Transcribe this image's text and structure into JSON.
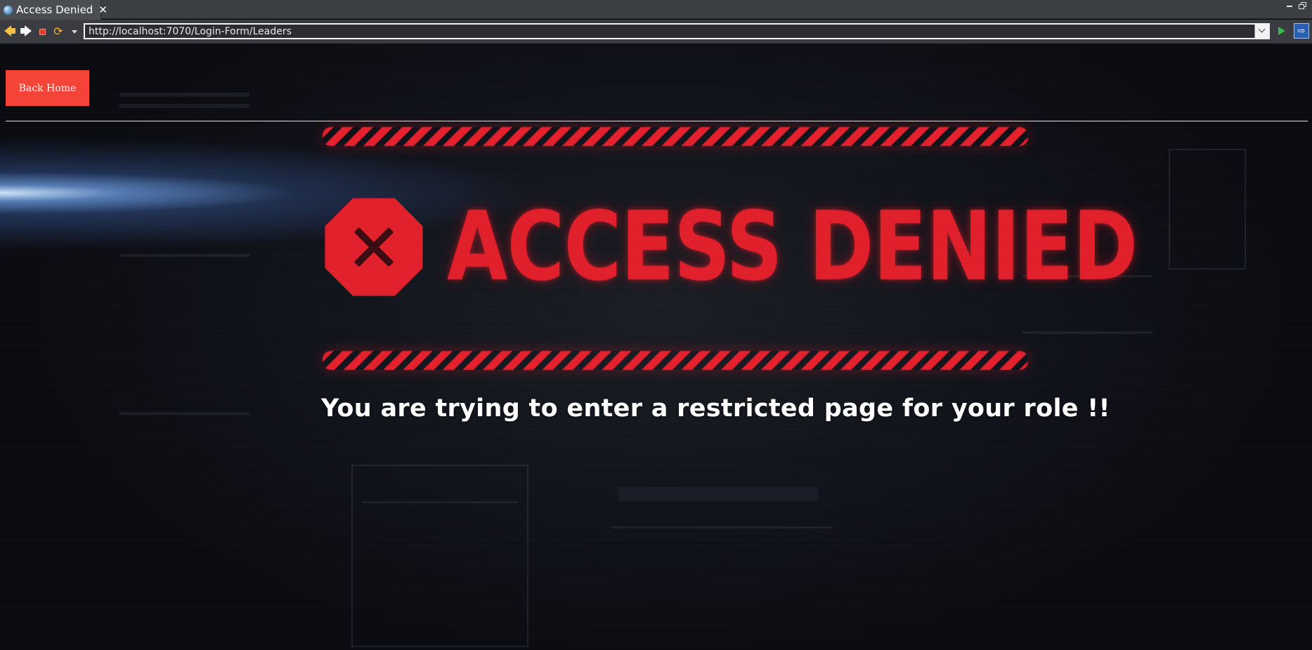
{
  "browser": {
    "tab_title": "Access Denied",
    "tab_close": "✕",
    "url": "http://localhost:7070/Login-Form/Leaders",
    "back_glyph": "🡄",
    "forward_glyph": "🡆",
    "refresh_glyph": "⟳",
    "external_glyph": "⇨"
  },
  "page": {
    "back_home_label": "Back Home",
    "banner_title": "ACCESS DENIED",
    "message": "You are trying to enter a restricted page for your role !!"
  },
  "colors": {
    "accent_red": "#f44336",
    "banner_red": "#e01f2b",
    "background": "#0d0f14"
  }
}
